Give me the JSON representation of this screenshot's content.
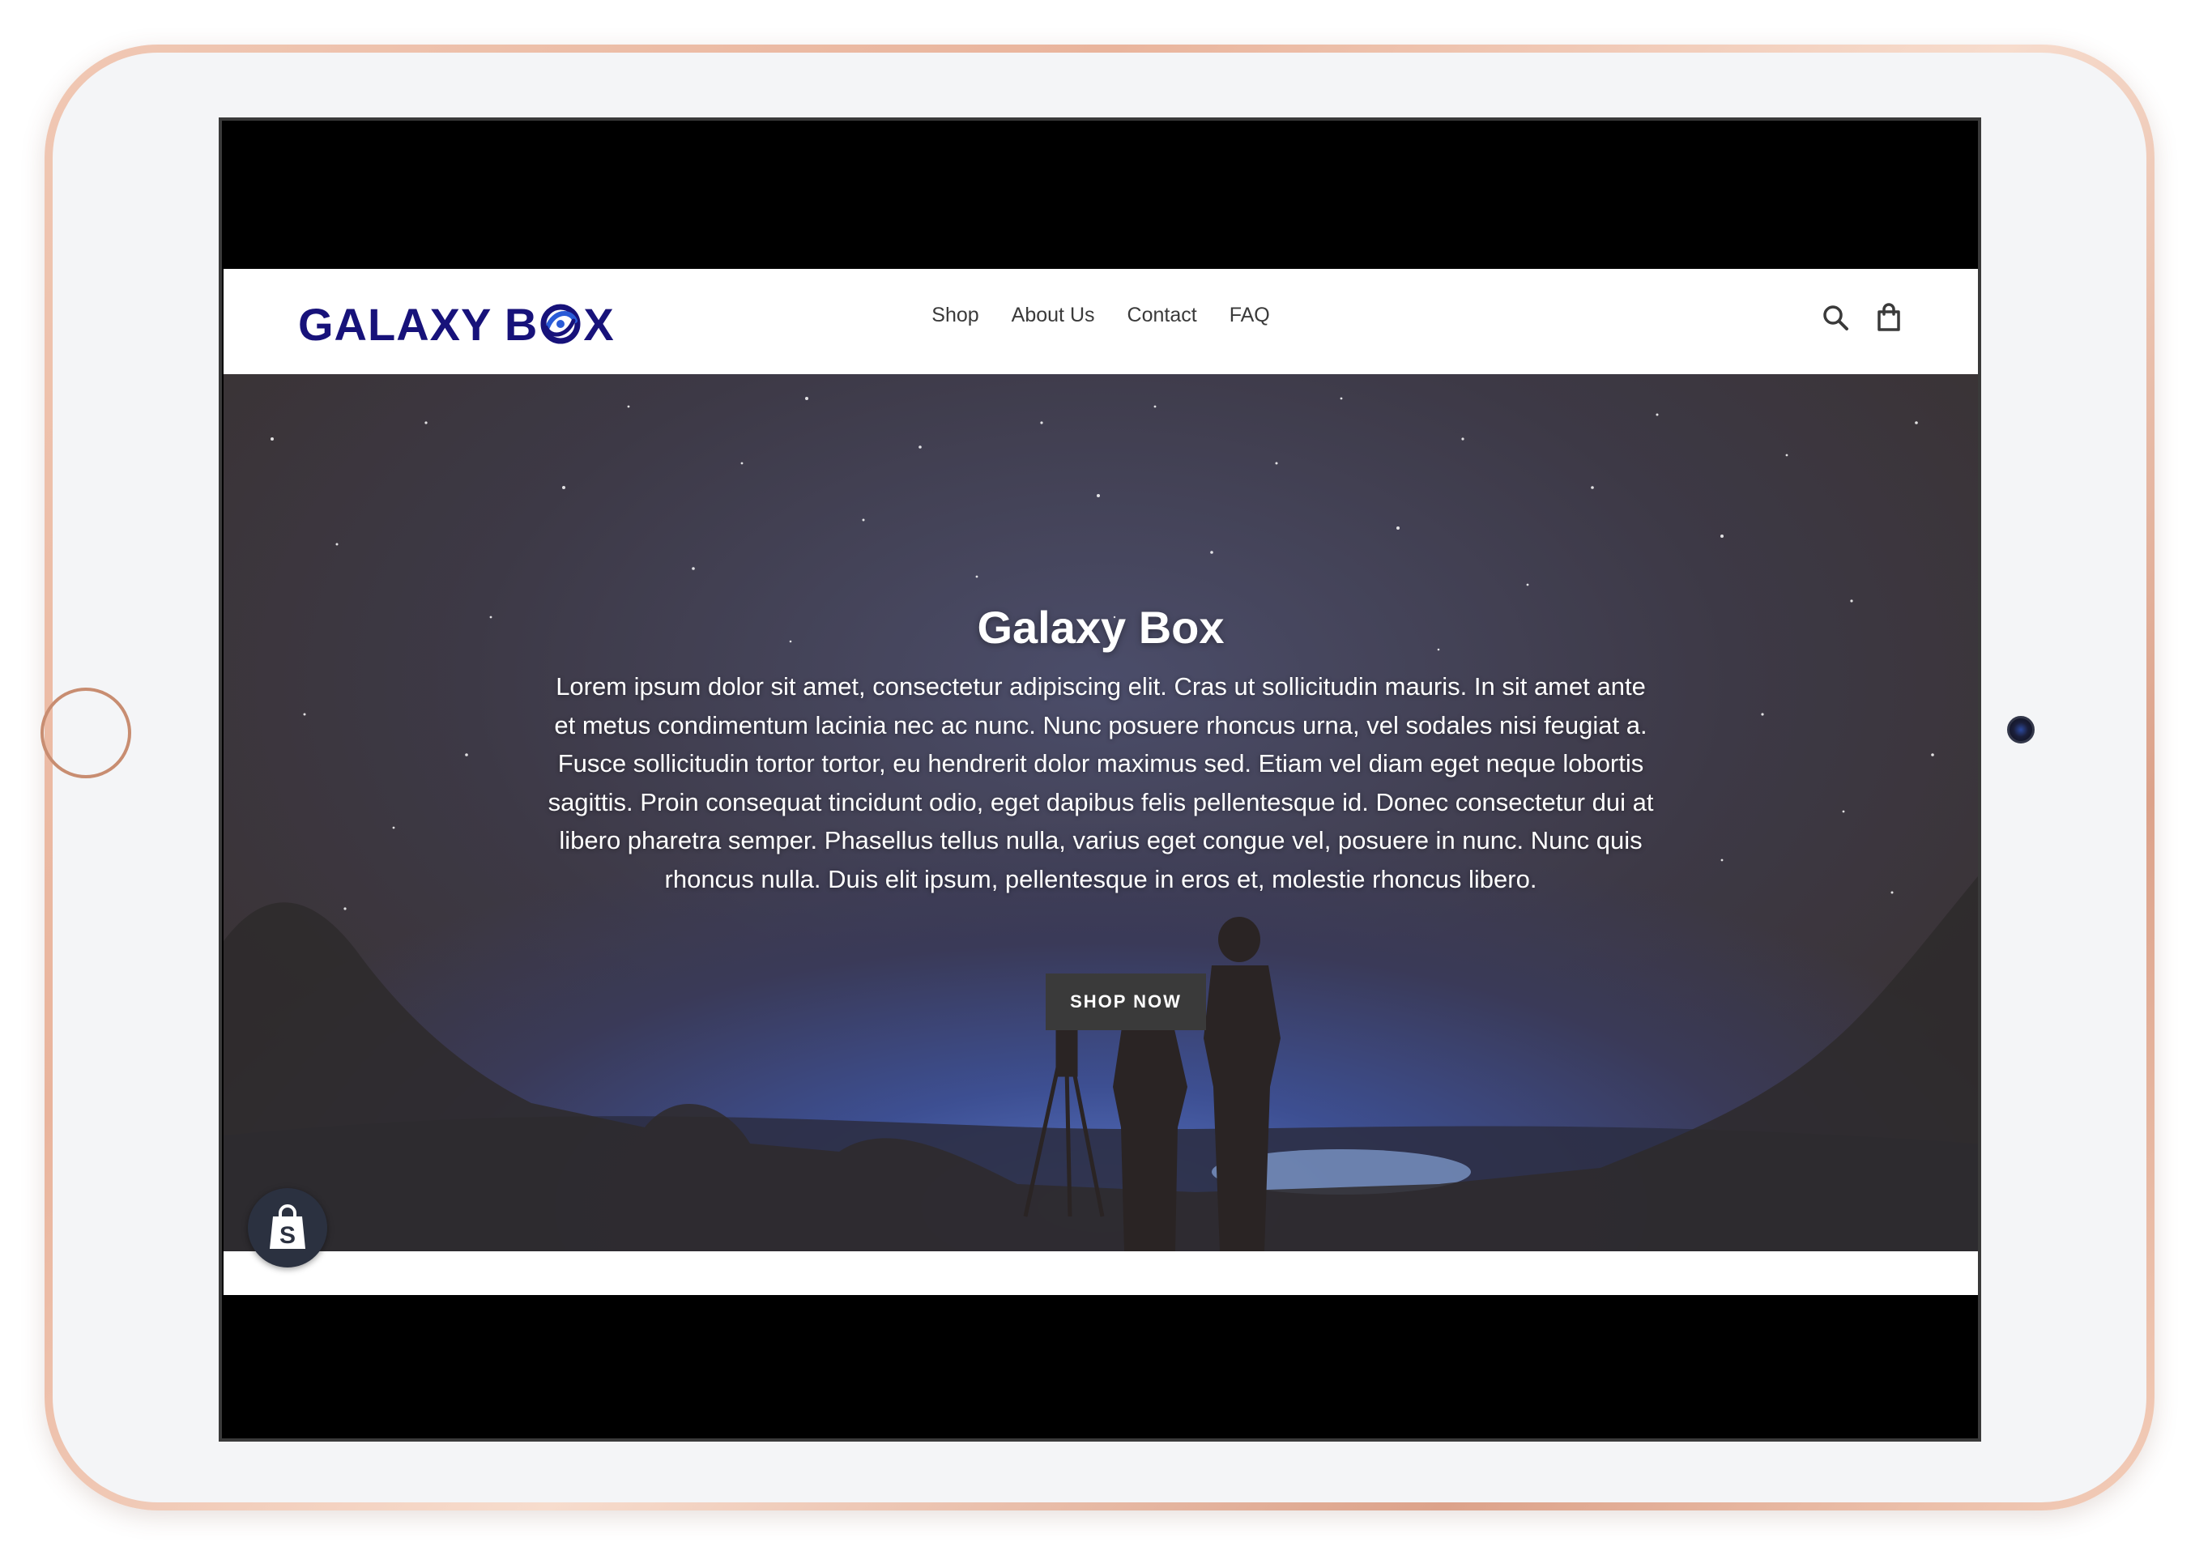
{
  "site": {
    "logo_text_left": "GALAXY B",
    "logo_text_right": "X",
    "logo_color": "#17127a"
  },
  "nav": {
    "items": [
      {
        "label": "Shop"
      },
      {
        "label": "About Us"
      },
      {
        "label": "Contact"
      },
      {
        "label": "FAQ"
      }
    ]
  },
  "header_icons": {
    "search": "search-icon",
    "cart": "cart-icon"
  },
  "hero": {
    "title": "Galaxy Box",
    "text": "Lorem ipsum dolor sit amet, consectetur adipiscing elit. Cras ut sollicitudin mauris. In sit amet ante et metus condimentum lacinia nec ac nunc. Nunc posuere rhoncus urna, vel sodales nisi feugiat a. Fusce sollicitudin tortor tortor, eu hendrerit dolor maximus sed. Etiam vel diam eget neque lobortis sagittis. Proin consequat tincidunt odio, eget dapibus felis pellentesque id. Donec consectetur dui at libero pharetra semper. Phasellus tellus nulla, varius eget congue vel, posuere in nunc. Nunc quis rhoncus nulla. Duis elit ipsum, pellentesque in eros et, molestie rhoncus libero.",
    "button_label": "SHOP NOW"
  },
  "badge": {
    "icon": "shopify-bag-icon"
  },
  "colors": {
    "device_frame": "#e9b49c",
    "device_face": "#f4f5f7",
    "button_bg": "#3a3a3a",
    "hero_text": "#ffffff"
  }
}
